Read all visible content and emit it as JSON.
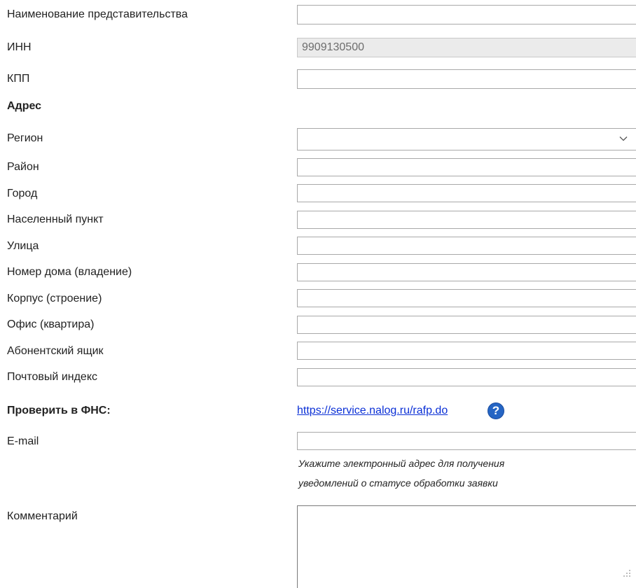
{
  "form": {
    "name": {
      "label": "Наименование представительства",
      "value": ""
    },
    "inn": {
      "label": "ИНН",
      "value": "9909130500"
    },
    "kpp": {
      "label": "КПП",
      "value": ""
    },
    "address_heading": "Адрес",
    "region": {
      "label": "Регион",
      "value": ""
    },
    "district": {
      "label": "Район",
      "value": ""
    },
    "city": {
      "label": "Город",
      "value": ""
    },
    "locality": {
      "label": "Населенный пункт",
      "value": ""
    },
    "street": {
      "label": "Улица",
      "value": ""
    },
    "house": {
      "label": "Номер дома (владение)",
      "value": ""
    },
    "building": {
      "label": "Корпус (строение)",
      "value": ""
    },
    "office": {
      "label": "Офис (квартира)",
      "value": ""
    },
    "po_box": {
      "label": "Абонентский ящик",
      "value": ""
    },
    "postcode": {
      "label": "Почтовый индекс",
      "value": ""
    },
    "fns_check": {
      "label": "Проверить в ФНС:",
      "link_text": "https://service.nalog.ru/rafp.do",
      "help_icon": "question-circle-icon",
      "help_glyph": "?"
    },
    "email": {
      "label": "E-mail",
      "value": "",
      "hint_line1": "Укажите электронный адрес для получения",
      "hint_line2": "уведомлений о статусе обработки заявки"
    },
    "comment": {
      "label": "Комментарий",
      "value": ""
    }
  },
  "colors": {
    "link": "#0b30d6",
    "help_icon": "#2565c4",
    "readonly_bg": "#ebebeb"
  }
}
